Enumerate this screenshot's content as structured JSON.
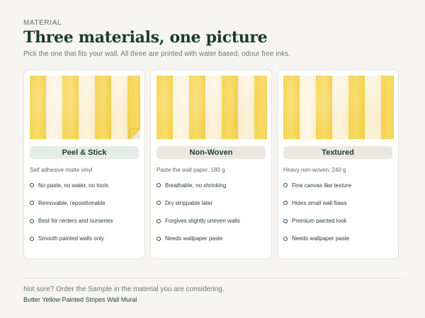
{
  "header": {
    "eyebrow": "MATERIAL",
    "title": "Three materials, one picture",
    "subtitle": "Pick the one that fits your wall. All three are printed with water based, odour free inks."
  },
  "colors": {
    "stripe_yellow": "#f6d553",
    "stripe_cream": "#fbf3dc",
    "ink_green": "#1f3d33",
    "pill_green": "#e3ece6",
    "pill_neutral": "#ebe7e1"
  },
  "materials": [
    {
      "name": "Peel & Stick",
      "spec": "Self adhesive matte vinyl",
      "features": [
        "No paste, no water, no tools",
        "Removable, repositionable",
        "Best for renters and nurseries",
        "Smooth painted walls only"
      ]
    },
    {
      "name": "Non-Woven",
      "spec": "Paste the wall paper, 180 g",
      "features": [
        "Breathable, no shrinking",
        "Dry strippable later",
        "Forgives slightly uneven walls",
        "Needs wallpaper paste"
      ]
    },
    {
      "name": "Textured",
      "spec": "Heavy non-woven, 240 g",
      "features": [
        "Fine canvas like texture",
        "Hides small wall flaws",
        "Premium painted look",
        "Needs wallpaper paste"
      ]
    }
  ],
  "footer": {
    "note": "Not sure? Order the Sample in the material you are considering.",
    "product": "Butter Yellow Painted Stripes Wall Mural"
  }
}
